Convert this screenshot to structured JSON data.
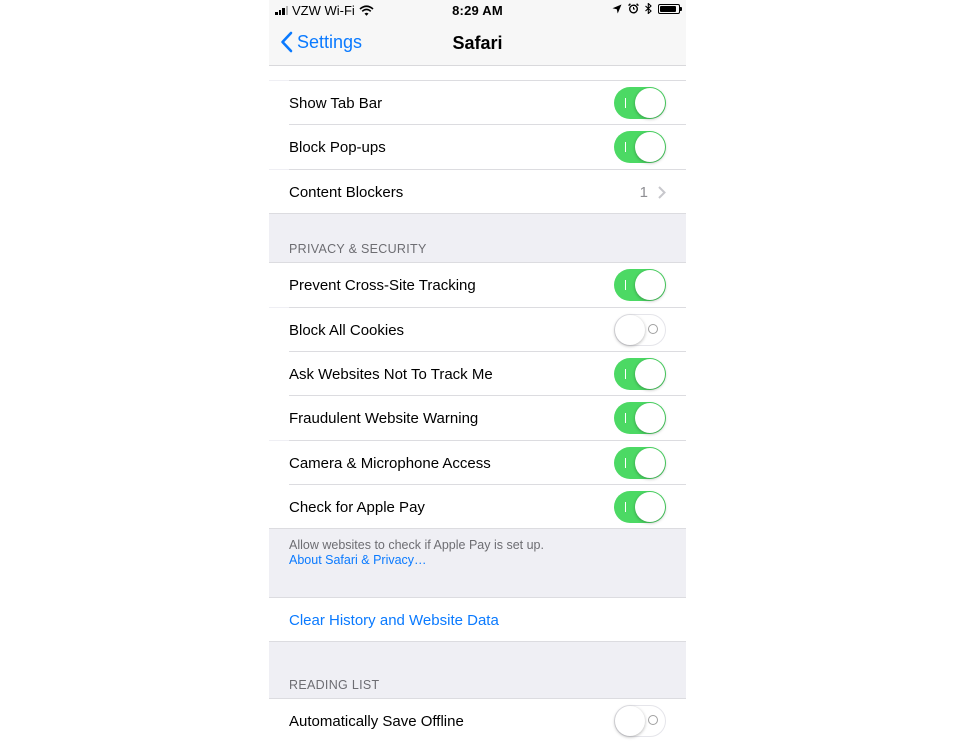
{
  "status_bar": {
    "carrier": "VZW Wi-Fi",
    "time": "8:29 AM",
    "battery_level": 0.9
  },
  "nav": {
    "back_label": "Settings",
    "title": "Safari"
  },
  "general": {
    "show_tab_bar": {
      "label": "Show Tab Bar",
      "on": true
    },
    "block_popups": {
      "label": "Block Pop-ups",
      "on": true
    },
    "content_blockers": {
      "label": "Content Blockers",
      "value": "1"
    }
  },
  "privacy": {
    "header": "PRIVACY & SECURITY",
    "cross_site": {
      "label": "Prevent Cross-Site Tracking",
      "on": true
    },
    "block_cookies": {
      "label": "Block All Cookies",
      "on": false
    },
    "do_not_track": {
      "label": "Ask Websites Not To Track Me",
      "on": true
    },
    "fraud_warning": {
      "label": "Fraudulent Website Warning",
      "on": true
    },
    "camera_mic": {
      "label": "Camera & Microphone Access",
      "on": true
    },
    "apple_pay": {
      "label": "Check for Apple Pay",
      "on": true
    },
    "footer": "Allow websites to check if Apple Pay is set up.",
    "footer_link": "About Safari & Privacy…"
  },
  "clear": {
    "label": "Clear History and Website Data"
  },
  "reading_list": {
    "header": "READING LIST",
    "save_offline": {
      "label": "Automatically Save Offline",
      "on": false
    }
  },
  "colors": {
    "accent": "#0a7aff",
    "toggle_on": "#4cd964",
    "background": "#efeff4"
  }
}
